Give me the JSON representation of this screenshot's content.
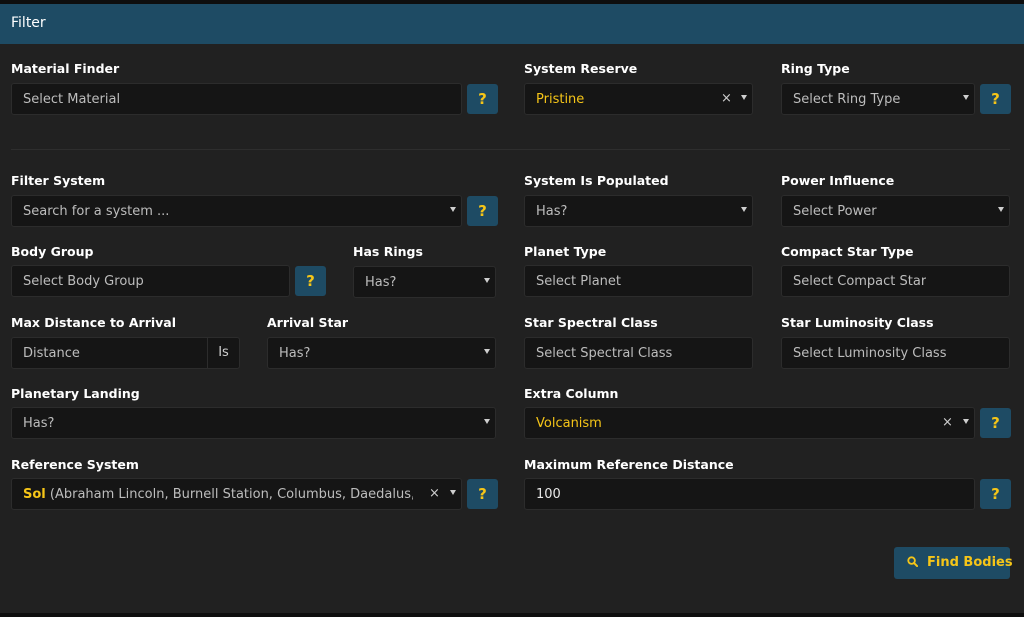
{
  "panel": {
    "title": "Filter"
  },
  "colors": {
    "header": "#1e4b64",
    "accent": "#f5c518",
    "panel": "#212121",
    "input": "#151515"
  },
  "material_finder": {
    "label": "Material Finder",
    "placeholder": "Select Material",
    "help": "?"
  },
  "system_reserve": {
    "label": "System Reserve",
    "value": "Pristine",
    "clear": "×"
  },
  "ring_type": {
    "label": "Ring Type",
    "placeholder": "Select Ring Type",
    "help": "?"
  },
  "filter_system": {
    "label": "Filter System",
    "placeholder": "Search for a system ...",
    "help": "?"
  },
  "system_populated": {
    "label": "System Is Populated",
    "value": "Has?"
  },
  "power_influence": {
    "label": "Power Influence",
    "placeholder": "Select Power"
  },
  "body_group": {
    "label": "Body Group",
    "placeholder": "Select Body Group",
    "help": "?"
  },
  "has_rings": {
    "label": "Has Rings",
    "value": "Has?"
  },
  "planet_type": {
    "label": "Planet Type",
    "placeholder": "Select Planet"
  },
  "compact_star_type": {
    "label": "Compact Star Type",
    "placeholder": "Select Compact Star"
  },
  "max_distance": {
    "label": "Max Distance to Arrival",
    "placeholder": "Distance",
    "addon": "Is"
  },
  "arrival_star": {
    "label": "Arrival Star",
    "value": "Has?"
  },
  "star_spectral_class": {
    "label": "Star Spectral Class",
    "placeholder": "Select Spectral Class"
  },
  "star_luminosity_class": {
    "label": "Star Luminosity Class",
    "placeholder": "Select Luminosity Class"
  },
  "planetary_landing": {
    "label": "Planetary Landing",
    "value": "Has?"
  },
  "extra_column": {
    "label": "Extra Column",
    "value": "Volcanism",
    "clear": "×",
    "help": "?"
  },
  "reference_system": {
    "label": "Reference System",
    "value_name": "Sol",
    "value_detail": " (Abraham Lincoln, Burnell Station, Columbus, Daedalus, De...",
    "clear": "×",
    "help": "?"
  },
  "max_reference_distance": {
    "label": "Maximum Reference Distance",
    "value": "100",
    "help": "?"
  },
  "find_button": {
    "label": "Find Bodies",
    "icon": "search-icon"
  }
}
